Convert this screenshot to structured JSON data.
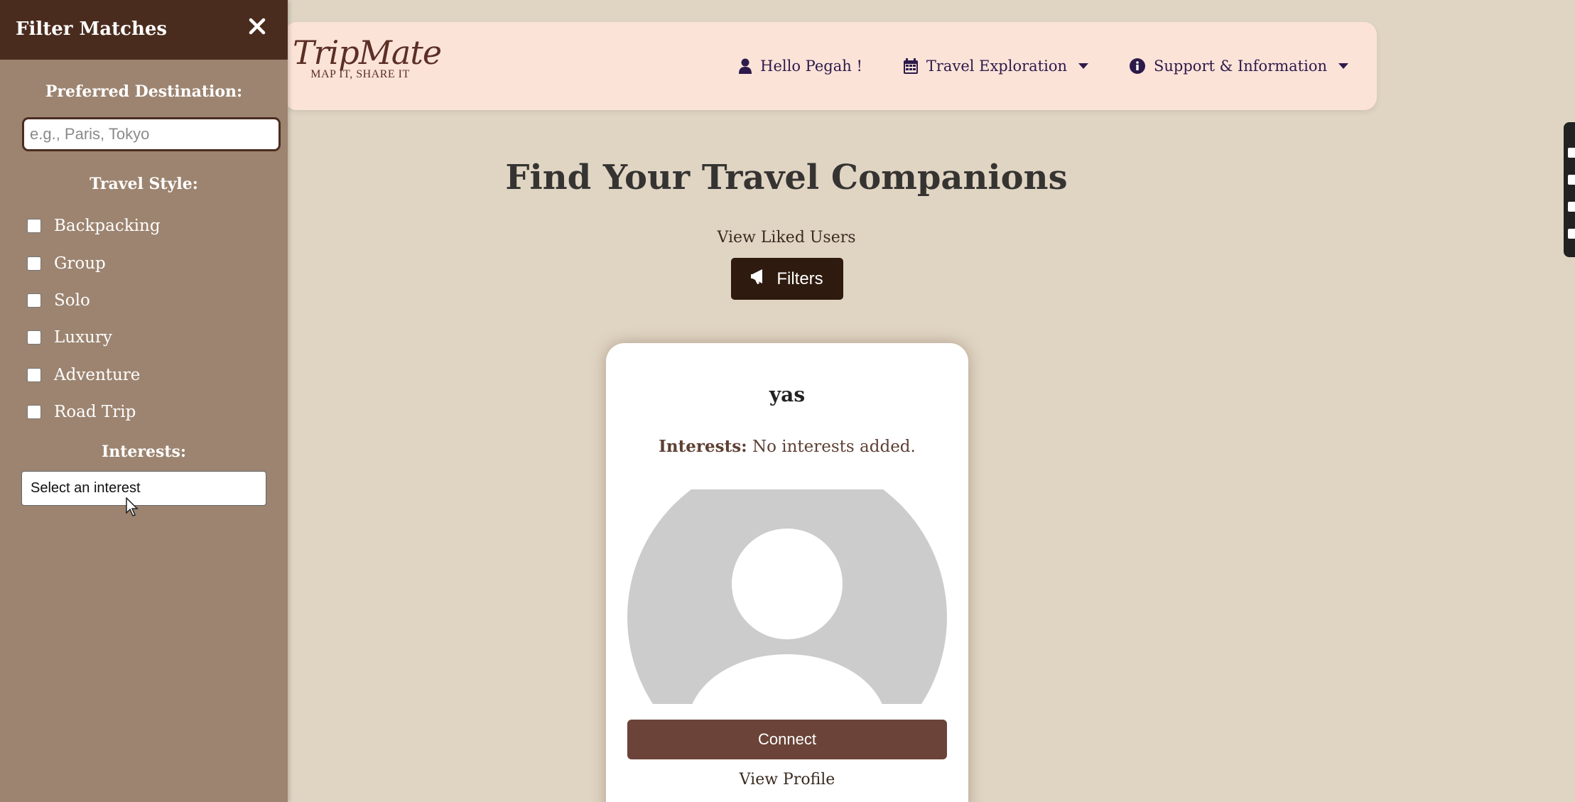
{
  "sidebar": {
    "title": "Filter Matches",
    "destination_label": "Preferred Destination:",
    "destination_placeholder": "e.g., Paris, Tokyo",
    "destination_value": "",
    "travel_style_label": "Travel Style:",
    "travel_styles": [
      "Backpacking",
      "Group",
      "Solo",
      "Luxury",
      "Adventure",
      "Road Trip"
    ],
    "interests_label": "Interests:",
    "interests_selected": "Select an interest"
  },
  "navbar": {
    "logo_script": "TripMate",
    "logo_tagline": "MAP IT, SHARE IT",
    "greeting": "Hello Pegah !",
    "travel_exploration": "Travel Exploration",
    "support": "Support & Information"
  },
  "main": {
    "title": "Find Your Travel Companions",
    "liked_link": "View Liked Users",
    "filters_button": "Filters"
  },
  "card": {
    "name": "yas",
    "interests_label": "Interests:",
    "interests_value": "No interests added.",
    "connect_button": "Connect",
    "view_profile": "View Profile"
  },
  "colors": {
    "background": "#e0d5c3",
    "sidebar": "#9c8470",
    "sidebar_header": "#4a2c1e",
    "navbar": "#fce3d8",
    "filters_button": "#2e1a0e",
    "connect_button": "#6b4338"
  }
}
